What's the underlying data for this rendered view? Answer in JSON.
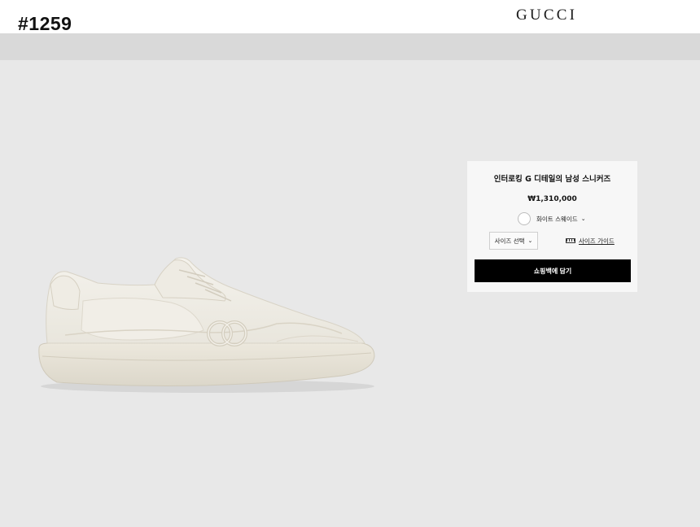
{
  "header": {
    "id_tag": "#1259",
    "logo": "GUCCI"
  },
  "product": {
    "image_icon": "sneaker-image",
    "title": "인터로킹 G 디테일의 남성 스니커즈",
    "price": "₩1,310,000",
    "color": {
      "label": "화이트 스웨이드",
      "swatch_color": "#ffffff",
      "chevron": "⌄"
    },
    "size_select": {
      "label": "사이즈 선택",
      "chevron": "⌄"
    },
    "size_guide": {
      "label": "사이즈 가이드",
      "icon": "ruler-icon"
    },
    "add_to_cart": "쇼핑백에 담기"
  }
}
